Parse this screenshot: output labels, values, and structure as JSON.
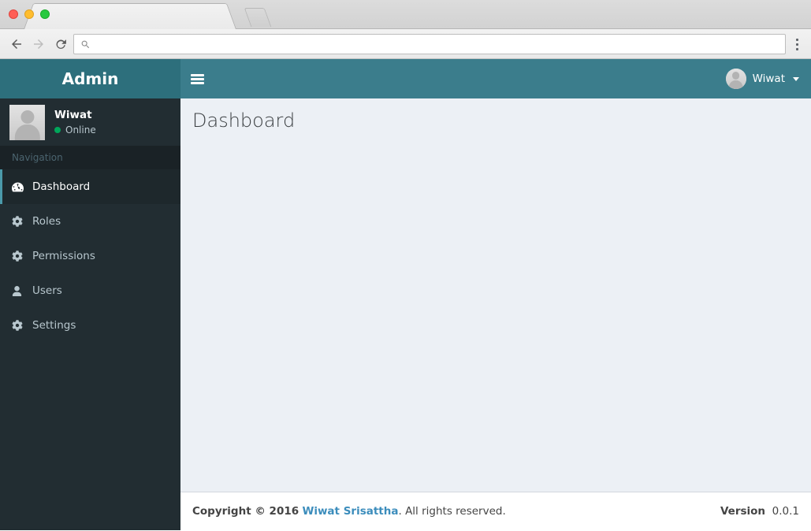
{
  "browser": {
    "tab_title": "",
    "address_value": "",
    "address_placeholder": "",
    "back_icon": "arrow-left-icon",
    "forward_icon": "arrow-right-icon",
    "reload_icon": "reload-icon",
    "search_icon": "search-icon",
    "menu_icon": "three-dot-menu-icon",
    "newtab_label": ""
  },
  "header": {
    "logo_text": "Admin",
    "toggle_icon": "hamburger-icon",
    "user": {
      "name": "Wiwat",
      "avatar_icon": "user-avatar-icon",
      "caret_icon": "caret-down-icon"
    }
  },
  "sidebar": {
    "user_panel": {
      "name": "Wiwat",
      "status": "Online",
      "status_color": "#00a65a",
      "avatar_icon": "user-avatar-icon"
    },
    "nav_header": "Navigation",
    "items": [
      {
        "label": "Dashboard",
        "icon": "dashboard-icon",
        "active": true
      },
      {
        "label": "Roles",
        "icon": "gear-icon",
        "active": false
      },
      {
        "label": "Permissions",
        "icon": "gear-icon",
        "active": false
      },
      {
        "label": "Users",
        "icon": "user-icon",
        "active": false
      },
      {
        "label": "Settings",
        "icon": "gear-icon",
        "active": false
      }
    ]
  },
  "content": {
    "page_title": "Dashboard"
  },
  "footer": {
    "copyright": "Copyright © 2016",
    "author_link": "Wiwat Srisattha",
    "rights": ". All rights reserved.",
    "version_label": "Version",
    "version_value": "0.0.1"
  },
  "colors": {
    "logo_bg": "#2d6f7c",
    "navbar_bg": "#3b7d8c",
    "sidebar_bg": "#222d32",
    "sidebar_active_bg": "#1e282c",
    "sidebar_active_border": "#4b9aaa",
    "content_bg": "#ecf0f5",
    "link_blue": "#3c8dbc",
    "online_green": "#00a65a"
  }
}
